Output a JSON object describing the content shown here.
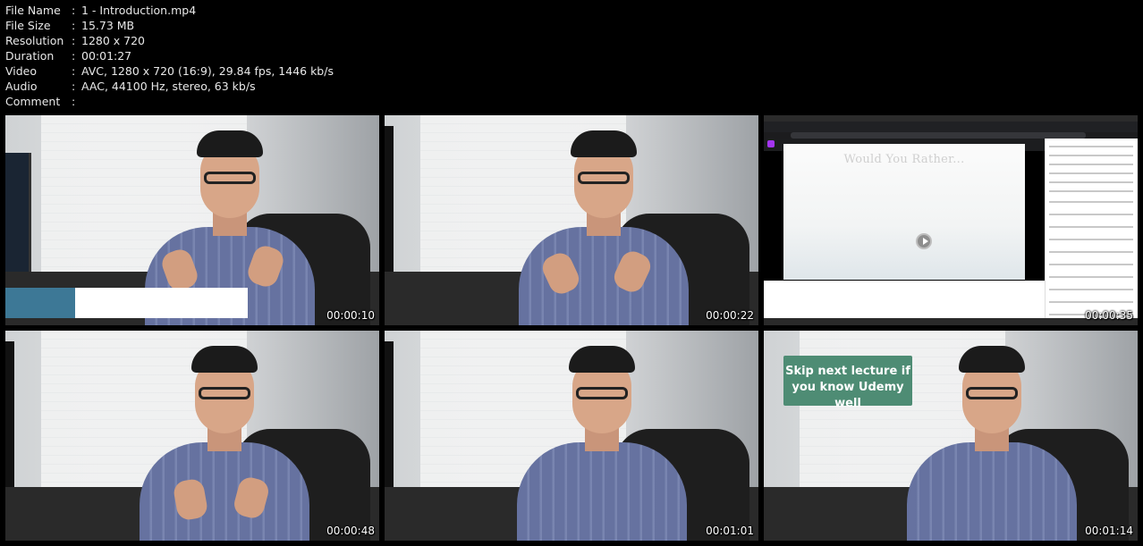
{
  "file_info": [
    {
      "label": "File Name",
      "sep": ":",
      "value": "1 - Introduction.mp4"
    },
    {
      "label": "File Size",
      "sep": ":",
      "value": "15.73 MB"
    },
    {
      "label": "Resolution",
      "sep": ":",
      "value": "1280 x 720"
    },
    {
      "label": "Duration",
      "sep": ":",
      "value": "00:01:27"
    },
    {
      "label": "Video",
      "sep": ":",
      "value": "AVC, 1280 x 720 (16:9), 29.84 fps, 1446 kb/s"
    },
    {
      "label": "Audio",
      "sep": ":",
      "value": "AAC, 44100 Hz, stereo, 63 kb/s"
    },
    {
      "label": "Comment",
      "sep": ":",
      "value": ""
    }
  ],
  "thumbnails": [
    {
      "timestamp": "00:00:10"
    },
    {
      "timestamp": "00:00:22"
    },
    {
      "timestamp": "00:00:35",
      "slide_title": "Would You Rather..."
    },
    {
      "timestamp": "00:00:48"
    },
    {
      "timestamp": "00:01:01"
    },
    {
      "timestamp": "00:01:14",
      "callout": "Skip next lecture if you know Udemy well"
    }
  ],
  "colors": {
    "background": "#000000",
    "callout": "#4e8c74",
    "lower_third": "#3d7896"
  }
}
